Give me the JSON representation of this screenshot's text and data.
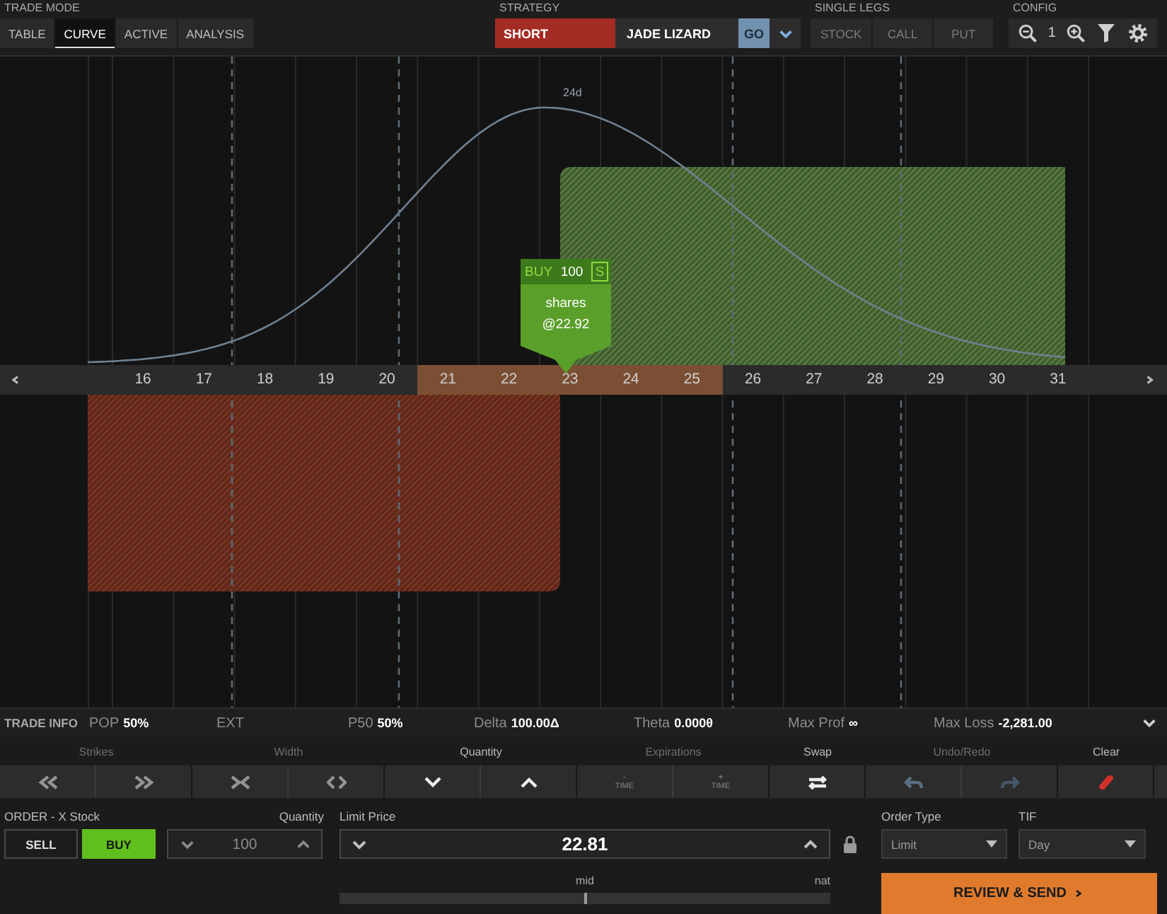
{
  "trade_mode": {
    "label": "TRADE MODE",
    "tabs": [
      {
        "label": "TABLE",
        "selected": false
      },
      {
        "label": "CURVE",
        "selected": true
      },
      {
        "label": "ACTIVE",
        "selected": false
      },
      {
        "label": "ANALYSIS",
        "selected": false
      }
    ]
  },
  "strategy": {
    "label": "STRATEGY",
    "direction": {
      "kind": "short",
      "label": "SHORT"
    },
    "name": "JADE LIZARD",
    "go_button": "GO"
  },
  "single_legs": {
    "label": "SINGLE LEGS",
    "buttons": [
      "STOCK",
      "CALL",
      "PUT"
    ]
  },
  "config": {
    "label": "CONFIG",
    "zoom": "1"
  },
  "curve": {
    "expiration_label": "24d",
    "tooltip": {
      "kind": "buy",
      "side": "BUY",
      "quantity": "100",
      "unit_badge": "S",
      "description": "shares",
      "price": "@22.92"
    },
    "strikes": [
      {
        "label": "16",
        "in_range": false
      },
      {
        "label": "17",
        "in_range": false
      },
      {
        "label": "18",
        "in_range": false
      },
      {
        "label": "19",
        "in_range": false
      },
      {
        "label": "20",
        "in_range": false
      },
      {
        "label": "21",
        "in_range": true
      },
      {
        "label": "22",
        "in_range": true
      },
      {
        "label": "23",
        "in_range": true
      },
      {
        "label": "24",
        "in_range": true
      },
      {
        "label": "25",
        "in_range": true
      },
      {
        "label": "26",
        "in_range": false
      },
      {
        "label": "27",
        "in_range": false
      },
      {
        "label": "28",
        "in_range": false
      },
      {
        "label": "29",
        "in_range": false
      },
      {
        "label": "30",
        "in_range": false
      },
      {
        "label": "31",
        "in_range": false
      }
    ]
  },
  "trade_info": {
    "title": "TRADE INFO",
    "items": [
      {
        "label": "POP",
        "value": "50%"
      },
      {
        "label": "EXT"
      },
      {
        "label": "P50",
        "value": "50%"
      },
      {
        "label": "Delta",
        "value": "100.00Δ"
      },
      {
        "label": "Theta",
        "value": "0.000θ"
      },
      {
        "label": "Max Prof",
        "value": "∞"
      },
      {
        "label": "Max Loss",
        "value": "-2,281.00"
      }
    ]
  },
  "toolbar": {
    "groups": [
      {
        "label": "Strikes",
        "disabled": true,
        "buttons": [
          {
            "kind": "double-left"
          },
          {
            "kind": "double-right"
          }
        ]
      },
      {
        "label": "Width",
        "disabled": true,
        "buttons": [
          {
            "kind": "inward"
          },
          {
            "kind": "outward"
          }
        ]
      },
      {
        "label": "Quantity",
        "disabled": false,
        "buttons": [
          {
            "kind": "down"
          },
          {
            "kind": "up"
          }
        ]
      },
      {
        "label": "Expirations",
        "disabled": true,
        "buttons": [
          {
            "kind": "time-minus",
            "sign": "-",
            "label": "TIME"
          },
          {
            "kind": "time-plus",
            "sign": "+",
            "label": "TIME"
          }
        ]
      },
      {
        "label": "Swap",
        "disabled": false,
        "buttons": [
          {
            "kind": "swap"
          }
        ]
      },
      {
        "label": "Undo/Redo",
        "disabled": true,
        "buttons": [
          {
            "kind": "undo"
          },
          {
            "kind": "redo"
          }
        ]
      },
      {
        "label": "Clear",
        "disabled": false,
        "buttons": [
          {
            "kind": "clear"
          }
        ]
      }
    ]
  },
  "order": {
    "title": "ORDER - X Stock",
    "sides": [
      {
        "label": "SELL",
        "selected": false
      },
      {
        "label": "BUY",
        "selected": true
      }
    ],
    "quantity": {
      "label": "Quantity",
      "value": "100",
      "disabled": true
    },
    "limit_price": {
      "label": "Limit Price",
      "value": "22.81",
      "locked": true
    },
    "price_slider": {
      "mid_label": "mid",
      "nat_label": "nat",
      "level": 0.5
    },
    "order_type": {
      "label": "Order Type",
      "value": "Limit"
    },
    "tif": {
      "label": "TIF",
      "value": "Day"
    },
    "submit_button": "REVIEW & SEND"
  }
}
